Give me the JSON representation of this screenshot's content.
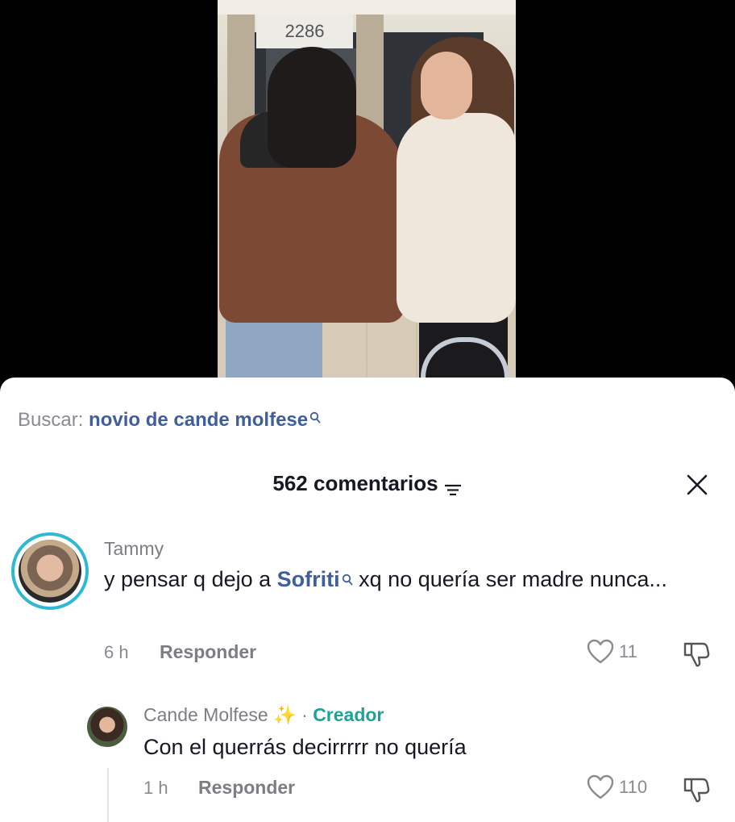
{
  "video": {
    "sign_number": "2286"
  },
  "search": {
    "prefix": "Buscar:",
    "term": "novio de cande molfese"
  },
  "comments_header": {
    "count_label": "562 comentarios"
  },
  "comments": [
    {
      "username": "Tammy",
      "text_before": "y pensar q dejo a ",
      "mention": "Sofriti",
      "text_after": " xq no quería ser madre nunca...",
      "time": "6 h",
      "reply_label": "Responder",
      "likes": "11"
    }
  ],
  "reply": {
    "username": "Cande Molfese",
    "separator": "·",
    "badge": "Creador",
    "text": "Con el querrás decirrrrr no quería",
    "time": "1 h",
    "reply_label": "Responder",
    "likes": "110"
  },
  "colors": {
    "accent_link": "#3f5f9c",
    "creator": "#1aa39a",
    "story_ring": "#2fb8d3"
  }
}
